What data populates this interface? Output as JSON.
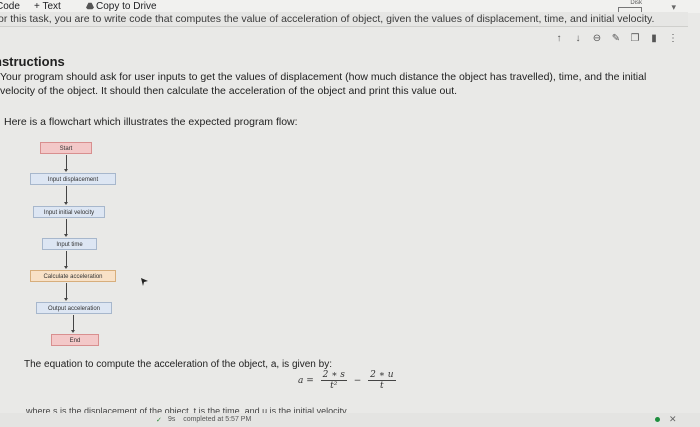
{
  "menu": {
    "code_label": "Code",
    "text_label": "+ Text",
    "copy_label": "Copy to Drive"
  },
  "runtime": {
    "disk_label": "Disk"
  },
  "intro_text": "or this task, you are to write code that computes the value of acceleration of object, given the values of displacement, time, and initial velocity.",
  "toolbar_icons": [
    "arrow-up-icon",
    "arrow-down-icon",
    "link-icon",
    "pencil-icon",
    "copy-icon",
    "trash-icon",
    "more-icon"
  ],
  "instructions": {
    "heading": "nstructions",
    "paragraph": "Your program should ask for user inputs to get the values of displacement (how much distance the object has travelled), time, and the initial velocity of the object. It should then calculate the acceleration of the object and print this value out.",
    "flow_intro": "Here is a flowchart which illustrates the expected program flow:"
  },
  "flowchart": {
    "start": "Start",
    "input_displacement": "Input displacement",
    "input_velocity": "Input initial velocity",
    "input_time": "Input time",
    "calculate": "Calculate acceleration",
    "output": "Output acceleration",
    "end": "End"
  },
  "equation": {
    "intro": "The equation to compute the acceleration of the object, a, is given by:",
    "lhs": "a =",
    "num1": "2 ∗ s",
    "den1": "t²",
    "minus": "−",
    "num2": "2 ∗ u",
    "den2": "t",
    "where": "where s is the displacement of the object, t is the time, and u is the initial velocity"
  },
  "status": {
    "check": "✓",
    "duration": "9s",
    "completed": "completed at 5:57 PM"
  },
  "colors": {
    "accent_green": "#1e8e3e",
    "flow_blue": "#dde6f3",
    "flow_terminal": "#f3c8c8",
    "flow_highlight": "#f8e1c7"
  }
}
